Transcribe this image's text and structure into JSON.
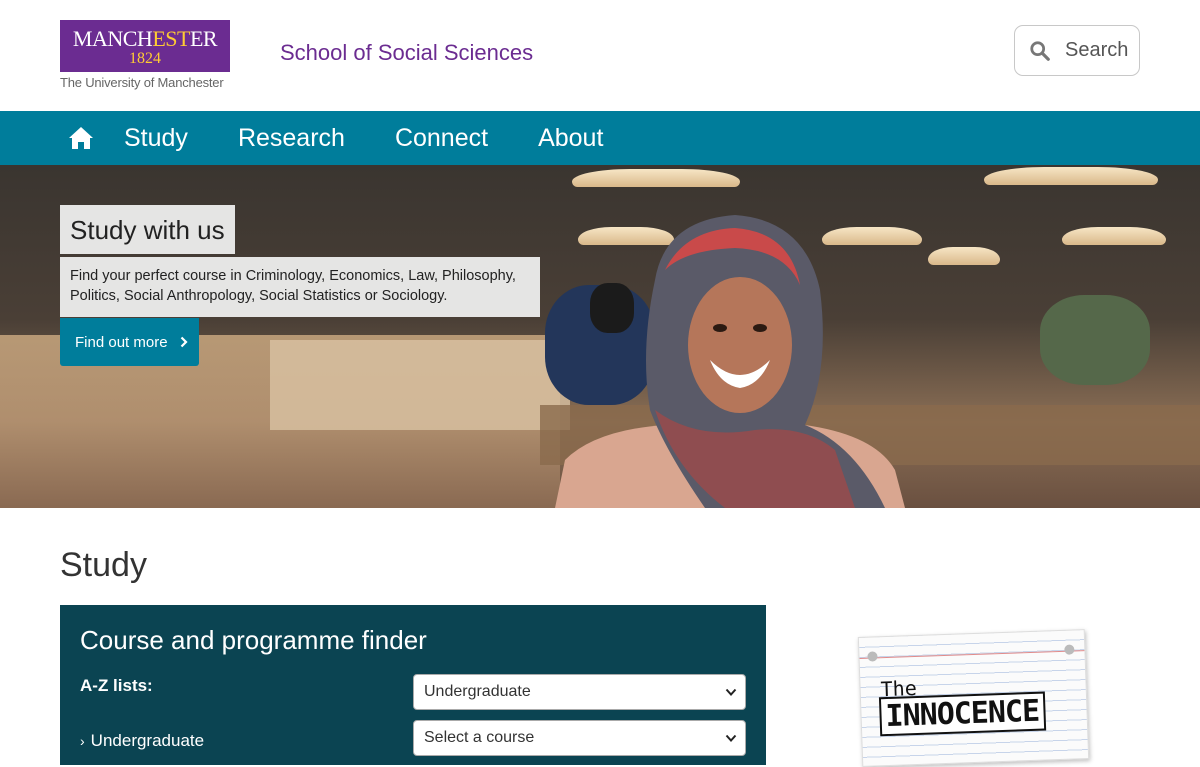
{
  "header": {
    "logo": {
      "word_start": "MANCH",
      "word_mid": "EST",
      "word_end": "ER",
      "year": "1824",
      "subtitle": "The University of Manchester"
    },
    "school_title": "School of Social Sciences",
    "search_label": "Search"
  },
  "nav": {
    "items": [
      {
        "label": "Study"
      },
      {
        "label": "Research"
      },
      {
        "label": "Connect"
      },
      {
        "label": "About"
      }
    ]
  },
  "hero": {
    "title": "Study with us",
    "text": "Find your perfect course in Criminology, Economics, Law, Philosophy, Politics, Social Anthropology, Social Statistics or Sociology.",
    "button_label": "Find out more"
  },
  "study": {
    "heading": "Study",
    "finder": {
      "title": "Course and programme finder",
      "az_label": "A-Z lists:",
      "az_selected": "Undergraduate",
      "second_label": "Undergraduate",
      "course_placeholder": "Select a course"
    }
  },
  "promo": {
    "the": "The",
    "innocence": "INNOCENCE"
  },
  "colors": {
    "brand_purple": "#6b2c91",
    "nav_teal": "#007d9b",
    "finder_dark": "#0b4452",
    "logo_gold": "#ffcc33"
  },
  "icons": [
    "search-icon",
    "home-icon",
    "chevron-right-icon",
    "chevron-down-icon"
  ]
}
